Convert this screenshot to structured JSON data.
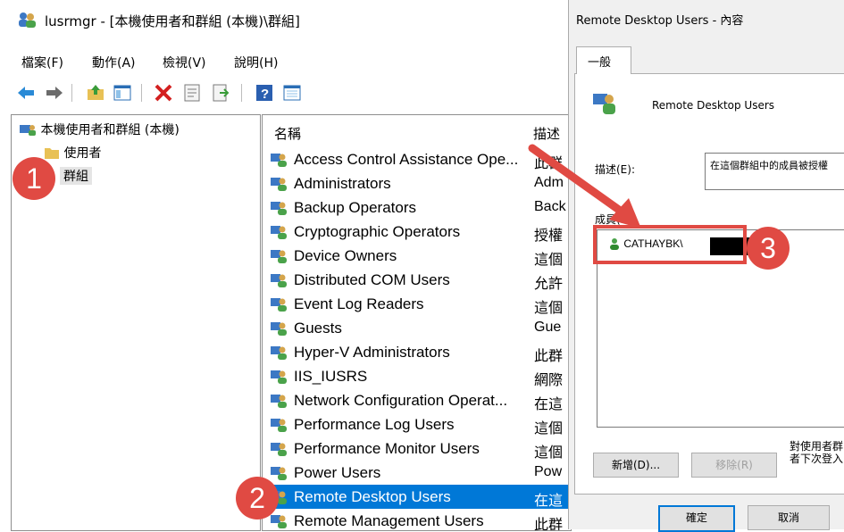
{
  "main_window": {
    "title": "lusrmgr - [本機使用者和群組 (本機)\\群組]",
    "menu": [
      "檔案(F)",
      "動作(A)",
      "檢視(V)",
      "說明(H)"
    ],
    "toolbar_icons": [
      "back-icon",
      "forward-icon",
      "up-folder-icon",
      "show-tree-icon",
      "delete-icon",
      "properties-icon",
      "export-icon",
      "help-icon",
      "show-console-icon"
    ]
  },
  "tree": {
    "root": "本機使用者和群組 (本機)",
    "items": [
      "使用者",
      "群組"
    ]
  },
  "list": {
    "columns": [
      "名稱",
      "描述"
    ],
    "rows": [
      {
        "name": "Access Control Assistance Ope...",
        "desc": "此群"
      },
      {
        "name": "Administrators",
        "desc": "Adm"
      },
      {
        "name": "Backup Operators",
        "desc": "Back"
      },
      {
        "name": "Cryptographic Operators",
        "desc": "授權"
      },
      {
        "name": "Device Owners",
        "desc": "這個"
      },
      {
        "name": "Distributed COM Users",
        "desc": "允許"
      },
      {
        "name": "Event Log Readers",
        "desc": "這個"
      },
      {
        "name": "Guests",
        "desc": "Gue"
      },
      {
        "name": "Hyper-V Administrators",
        "desc": "此群"
      },
      {
        "name": "IIS_IUSRS",
        "desc": "網際"
      },
      {
        "name": "Network Configuration Operat...",
        "desc": "在這"
      },
      {
        "name": "Performance Log Users",
        "desc": "這個"
      },
      {
        "name": "Performance Monitor Users",
        "desc": "這個"
      },
      {
        "name": "Power Users",
        "desc": "Pow"
      },
      {
        "name": "Remote Desktop Users",
        "desc": "在這"
      },
      {
        "name": "Remote Management Users",
        "desc": "此群"
      }
    ],
    "selected_index": 14
  },
  "dialog": {
    "title": "Remote Desktop Users - 內容",
    "tab": "一般",
    "group_name": "Remote Desktop Users",
    "desc_label": "描述(E):",
    "desc_value": "在這個群組中的成員被授權",
    "members_label": "成員(M):",
    "member": "CATHAYBK\\",
    "note": "對使用者群\n者下次登入",
    "add_button": "新增(D)...",
    "remove_button": "移除(R)",
    "ok_button": "確定",
    "cancel_button": "取消"
  },
  "annotations": {
    "callout_1": "1",
    "callout_2": "2",
    "callout_3": "3",
    "color": "#e04a43"
  },
  "colors": {
    "selection": "#0078d7"
  }
}
